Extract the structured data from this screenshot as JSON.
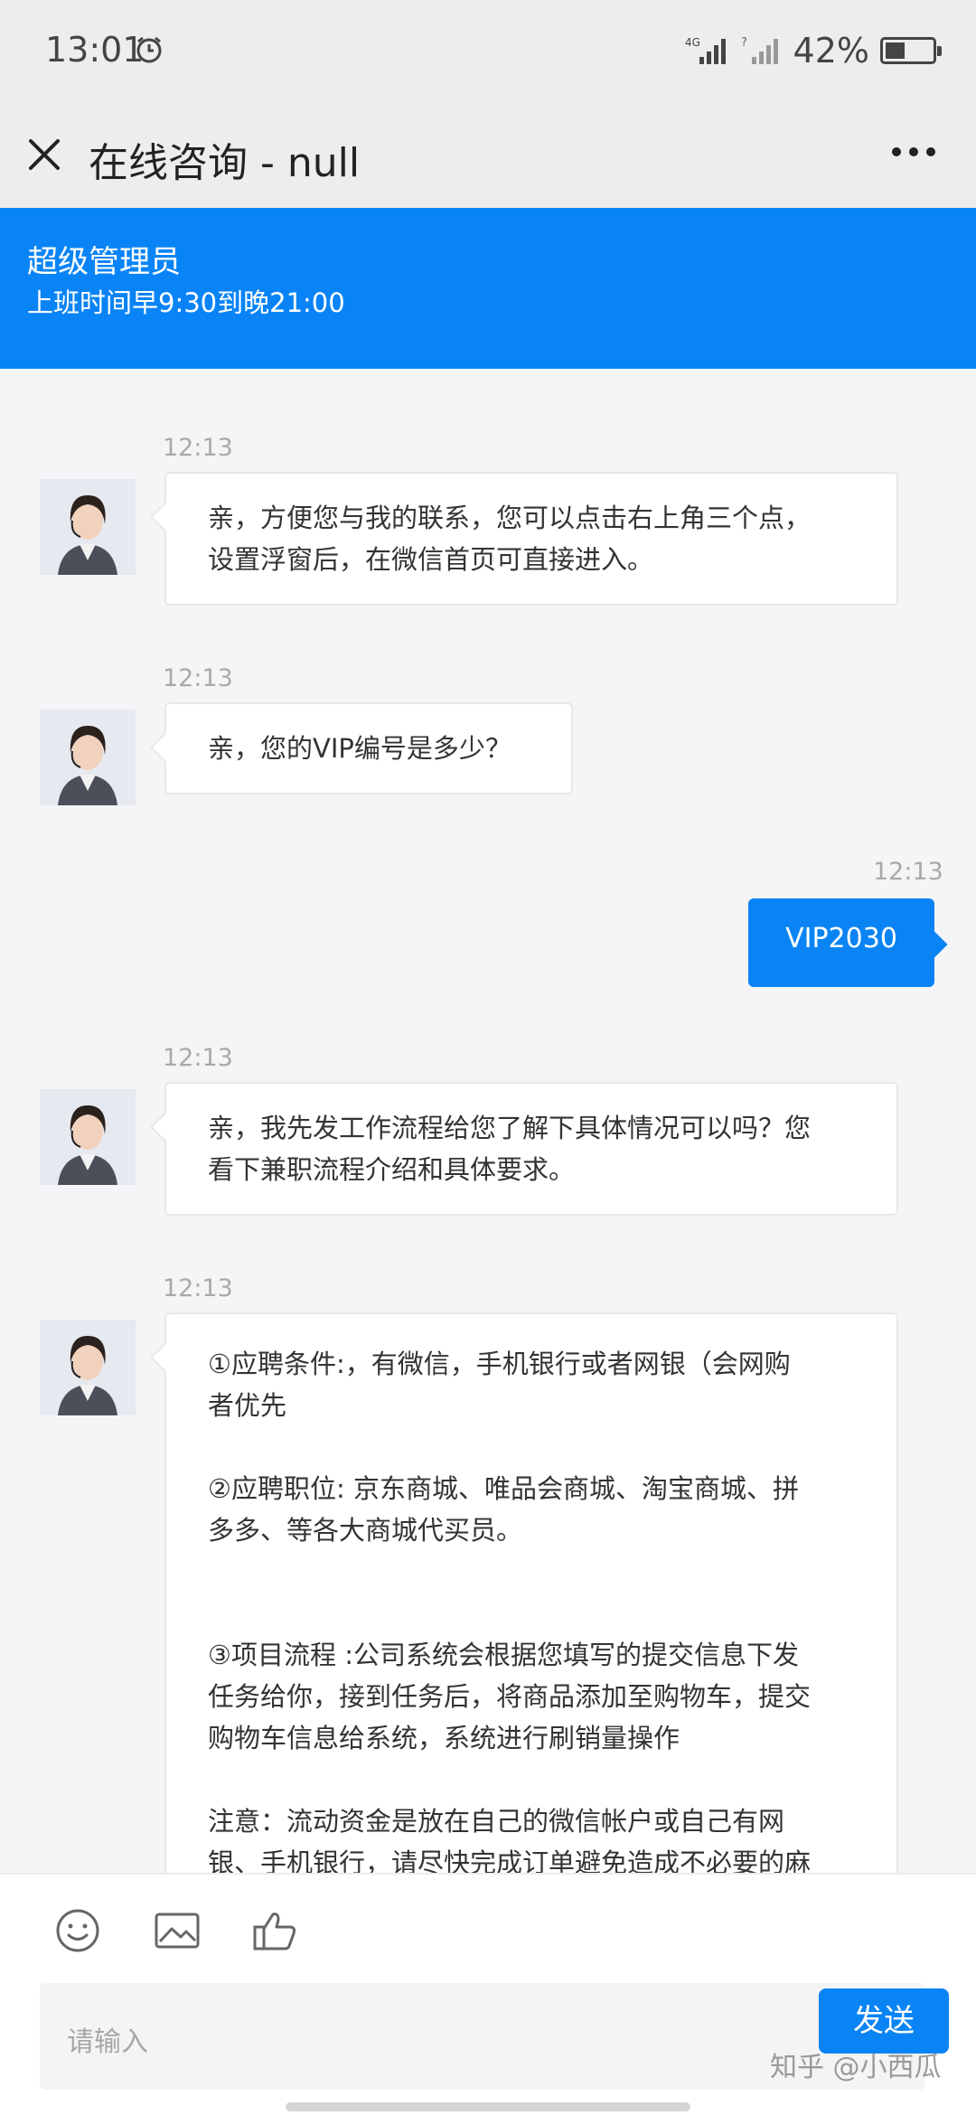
{
  "status_bar": {
    "time": "13:01",
    "battery": "42%",
    "battery_level_percent": 42,
    "icons": [
      "alarm-icon",
      "signal-4g-icon",
      "signal-icon",
      "battery-icon"
    ]
  },
  "title_bar": {
    "title": "在线咨询 - null",
    "close_icon": "close-icon",
    "more_icon": "more-icon"
  },
  "agent": {
    "name": "超级管理员",
    "hours": "上班时间早9:30到晚21:00"
  },
  "messages": [
    {
      "time": "12:13",
      "from": "agent",
      "text": "亲，方便您与我的联系，您可以点击右上角三个点，\n设置浮窗后，在微信首页可直接进入。"
    },
    {
      "time": "12:13",
      "from": "agent",
      "text": "亲，您的VIP编号是多少？"
    },
    {
      "time": "12:13",
      "from": "me",
      "text": "VIP2030"
    },
    {
      "time": "12:13",
      "from": "agent",
      "text": "亲，我先发工作流程给您了解下具体情况可以吗？您\n看下兼职流程介绍和具体要求。"
    },
    {
      "time": "12:13",
      "from": "agent",
      "text": "①应聘条件:，有微信，手机银行或者网银（会网购\n者优先\n\n②应聘职位: 京东商城、唯品会商城、淘宝商城、拼\n多多、等各大商城代买员。\n\n\n③项目流程 :公司系统会根据您填写的提交信息下发\n任务给你，接到任务后，将商品添加至购物车，提交\n购物车信息给系统，系统进行刷销量操作\n\n注意：流动资金是放在自己的微信帐户或自己有网\n银、手机银行，请尽快完成订单避免造成不必要的麻\n烦！接受订单前确保一定的流动资金避免卡单！"
    }
  ],
  "composer": {
    "placeholder": "请输入",
    "send_label": "发送",
    "tools": [
      "emoji-icon",
      "image-icon",
      "thumbs-up-icon"
    ]
  },
  "watermark": "知乎 @小西瓜",
  "colors": {
    "accent": "#0984f6",
    "header_bg": "#ededed",
    "chat_bg": "#f5f5f7"
  }
}
